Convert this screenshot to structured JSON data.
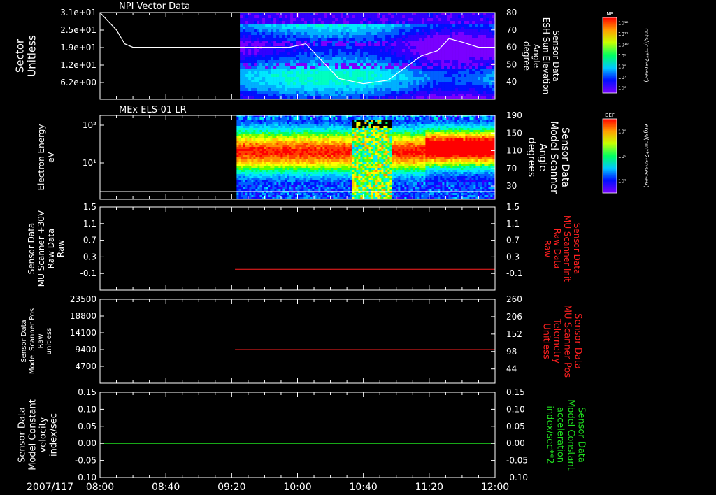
{
  "chart_data": [
    {
      "type": "heatmap",
      "title": "NPI Vector Data",
      "left_axis": {
        "label": [
          "Sector",
          "Unitless"
        ],
        "ticks": [
          "3.1e+01",
          "2.5e+01",
          "1.9e+01",
          "1.2e+01",
          "6.2e+00"
        ]
      },
      "right_axis": {
        "label": [
          "Sensor Data",
          "ESH Sun Elevation",
          "Angle",
          "degree"
        ],
        "ticks": [
          80,
          70,
          60,
          50,
          40
        ],
        "ylim": [
          30,
          80
        ]
      },
      "data_start_time": "09:25",
      "line_series": {
        "x": [
          "08:00",
          "08:10",
          "08:15",
          "08:20",
          "09:25",
          "09:55",
          "10:05",
          "10:15",
          "10:25",
          "10:40",
          "10:55",
          "11:05",
          "11:15",
          "11:25",
          "11:32",
          "11:40",
          "11:50",
          "12:00"
        ],
        "y": [
          80,
          70,
          62,
          60,
          60,
          60,
          62,
          52,
          42,
          39,
          41,
          48,
          55,
          58,
          65,
          63,
          60,
          60
        ]
      },
      "colorbar": {
        "label": "NF",
        "unit": "cnts/(cm**2-sr-sec)",
        "ticks": [
          "10¹²",
          "10¹¹",
          "10¹⁰",
          "10⁹",
          "10⁸",
          "10⁷",
          "10⁶"
        ]
      }
    },
    {
      "type": "heatmap",
      "title": "MEx ELS-01 LR",
      "left_axis": {
        "label": [
          "Electron Energy",
          "eV"
        ],
        "ticks": [
          "10²",
          "10¹"
        ]
      },
      "right_axis": {
        "label": [
          "Sensor Data",
          "Model Scanner",
          "Angle",
          "degrees"
        ],
        "ticks": [
          190,
          150,
          110,
          70,
          30
        ],
        "ylim": [
          0,
          190
        ]
      },
      "line_series": {
        "x": [
          "08:00",
          "12:00"
        ],
        "y": [
          0,
          0
        ]
      },
      "colorbar": {
        "label": "DEF",
        "unit": "ergs/(cm**2-sr-sec-eV)",
        "ticks": [
          "10⁹",
          "10⁸",
          "10⁷"
        ]
      }
    },
    {
      "type": "line",
      "left_axis": {
        "label": [
          "Sensor Data",
          "MU Scanner +30V",
          "Raw Data",
          "Raw"
        ],
        "ticks": [
          "1.5",
          "1.1",
          "0.7",
          "0.3",
          "-0.1"
        ],
        "ylim": [
          -0.5,
          1.5
        ]
      },
      "right_axis": {
        "label": [
          "Sensor Data",
          "MU Scanner Init",
          "Raw Data",
          "Raw"
        ],
        "ticks": [
          "1.5",
          "1.1",
          "0.7",
          "0.3",
          "-0.1"
        ],
        "ylim": [
          -0.5,
          1.5
        ],
        "color": "#ff2020"
      },
      "series": [
        {
          "x_start": "09:22",
          "x_end": "12:00",
          "y": 0.0,
          "color": "#ff2020"
        }
      ]
    },
    {
      "type": "line",
      "left_axis": {
        "label": [
          "Sensor Data",
          "Model Scanner Pos",
          "Raw",
          "unitless"
        ],
        "ticks": [
          "23500",
          "18800",
          "14100",
          "9400",
          "4700"
        ],
        "ylim": [
          0,
          23500
        ]
      },
      "right_axis": {
        "label": [
          "Sensor Data",
          "MU Scanner Pos",
          "Telemetry",
          "Unitless"
        ],
        "ticks": [
          260,
          206,
          152,
          98,
          44
        ],
        "ylim": [
          0,
          260
        ],
        "color": "#ff2020"
      },
      "series": [
        {
          "x_start": "09:22",
          "x_end": "12:00",
          "y": 9400,
          "color": "#ff2020"
        }
      ]
    },
    {
      "type": "line",
      "left_axis": {
        "label": [
          "Sensor Data",
          "Model Constant",
          "velocity",
          "index/sec"
        ],
        "ticks": [
          "0.15",
          "0.10",
          "0.05",
          "0.00",
          "-0.05",
          "-0.10"
        ],
        "ylim": [
          -0.1,
          0.15
        ]
      },
      "right_axis": {
        "label": [
          "Sensor Data",
          "Model Constant",
          "acceleration",
          "index/sec**2"
        ],
        "ticks": [
          "0.15",
          "0.10",
          "0.05",
          "0.00",
          "-0.05",
          "-0.10"
        ],
        "ylim": [
          -0.1,
          0.15
        ],
        "color": "#20e020"
      },
      "series": [
        {
          "x_start": "08:00",
          "x_end": "12:00",
          "y": 0.0,
          "color": "#20e020"
        }
      ]
    }
  ],
  "x_axis": {
    "date": "2007/117",
    "ticks": [
      "08:00",
      "08:40",
      "09:20",
      "10:00",
      "10:40",
      "11:20",
      "12:00"
    ],
    "xlim": [
      "08:00",
      "12:00"
    ]
  }
}
